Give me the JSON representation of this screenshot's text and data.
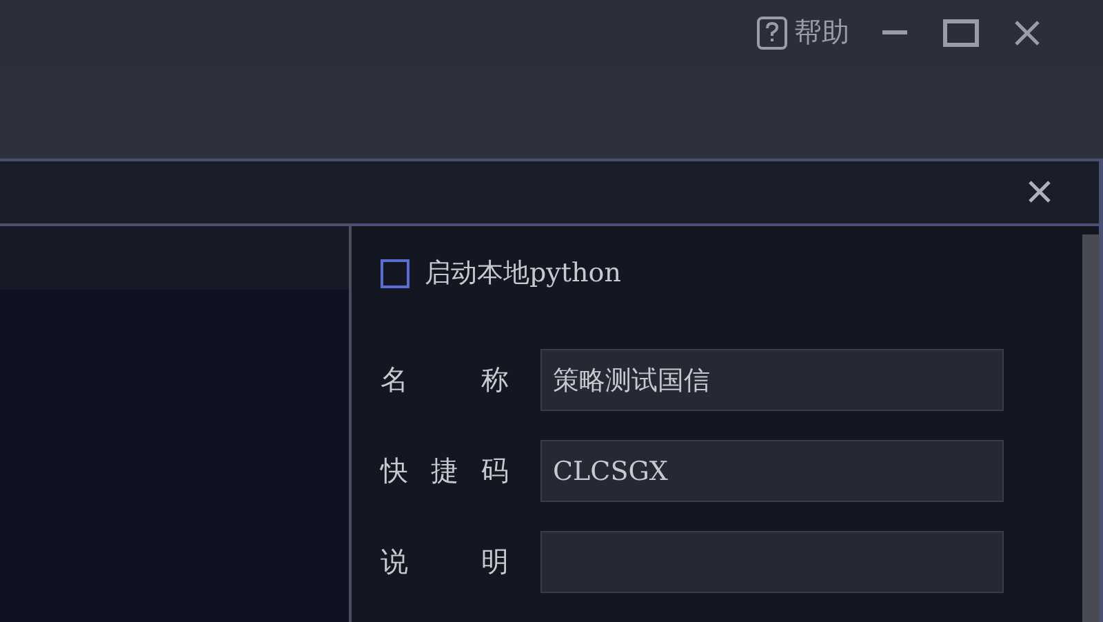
{
  "title_bar": {
    "help": {
      "label": "帮助"
    }
  },
  "dialog": {
    "panel": {
      "local_python": {
        "label": "启动本地python",
        "checked": false
      },
      "fields": [
        {
          "label": "名称",
          "value": "策略测试国信"
        },
        {
          "label": "快捷码",
          "value": "CLCSGX"
        },
        {
          "label": "说明"
        }
      ]
    }
  }
}
